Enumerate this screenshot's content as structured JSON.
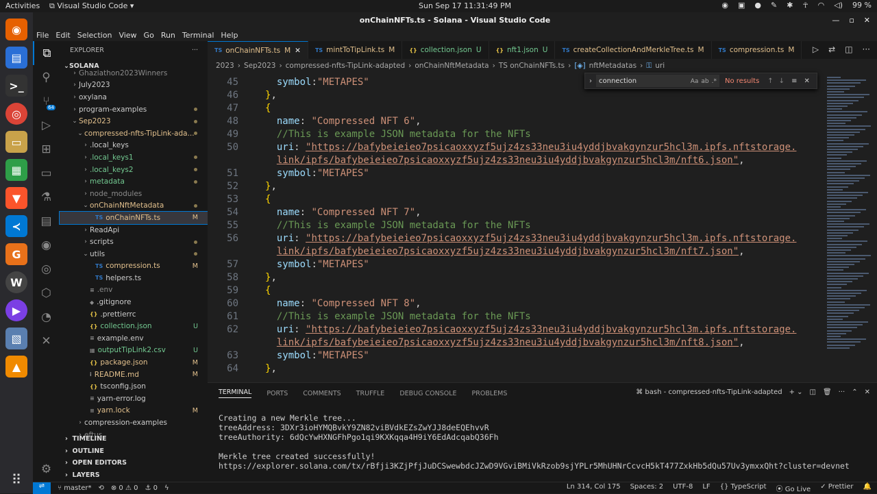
{
  "os": {
    "activities": "Activities",
    "app_name": "Visual Studio Code",
    "clock": "Sun Sep 17  11:31:49 PM",
    "battery": "99 %"
  },
  "window": {
    "title": "onChainNFTs.ts - Solana - Visual Studio Code"
  },
  "menu": [
    "File",
    "Edit",
    "Selection",
    "View",
    "Go",
    "Run",
    "Terminal",
    "Help"
  ],
  "activity": {
    "scm_badge": "64"
  },
  "explorer": {
    "header": "EXPLORER",
    "root": "SOLANA",
    "tree": [
      {
        "label": "Ghaziathon2023Winners",
        "depth": 1,
        "folder": true,
        "open": false,
        "color": "dim"
      },
      {
        "label": "July2023",
        "depth": 1,
        "folder": true,
        "open": false
      },
      {
        "label": "oxylana",
        "depth": 1,
        "folder": true,
        "open": false
      },
      {
        "label": "program-examples",
        "depth": 1,
        "folder": true,
        "open": false,
        "dot": true
      },
      {
        "label": "Sep2023",
        "depth": 1,
        "folder": true,
        "open": true,
        "color": "mod",
        "dot": true
      },
      {
        "label": "compressed-nfts-TipLink-ada...",
        "depth": 2,
        "folder": true,
        "open": true,
        "color": "mod",
        "dot": true
      },
      {
        "label": ".local_keys",
        "depth": 3,
        "folder": true,
        "open": false
      },
      {
        "label": ".local_keys1",
        "depth": 3,
        "folder": true,
        "open": false,
        "color": "untr",
        "dot": true
      },
      {
        "label": ".local_keys2",
        "depth": 3,
        "folder": true,
        "open": false,
        "color": "untr",
        "dot": true
      },
      {
        "label": "metadata",
        "depth": 3,
        "folder": true,
        "open": false,
        "color": "untr",
        "dot": true
      },
      {
        "label": "node_modules",
        "depth": 3,
        "folder": true,
        "open": false,
        "color": "dim"
      },
      {
        "label": "onChainNftMetadata",
        "depth": 3,
        "folder": true,
        "open": true,
        "color": "mod",
        "dot": true
      },
      {
        "label": "onChainNFTs.ts",
        "depth": 4,
        "icon": "TS",
        "status": "M",
        "color": "mod",
        "selected": true
      },
      {
        "label": "ReadApi",
        "depth": 3,
        "folder": true,
        "open": false
      },
      {
        "label": "scripts",
        "depth": 3,
        "folder": true,
        "open": false,
        "dot": true
      },
      {
        "label": "utils",
        "depth": 3,
        "folder": true,
        "open": true,
        "dot": true
      },
      {
        "label": "compression.ts",
        "depth": 4,
        "icon": "TS",
        "status": "M",
        "color": "mod"
      },
      {
        "label": "helpers.ts",
        "depth": 4,
        "icon": "TS"
      },
      {
        "label": ".env",
        "depth": 3,
        "icon": "≡",
        "color": "dim"
      },
      {
        "label": ".gitignore",
        "depth": 3,
        "icon": "◆"
      },
      {
        "label": ".prettierrc",
        "depth": 3,
        "icon": "{}"
      },
      {
        "label": "collection.json",
        "depth": 3,
        "icon": "{}",
        "status": "U",
        "color": "untr"
      },
      {
        "label": "example.env",
        "depth": 3,
        "icon": "≡"
      },
      {
        "label": "outputTipLink2.csv",
        "depth": 3,
        "icon": "▦",
        "status": "U",
        "color": "untr"
      },
      {
        "label": "package.json",
        "depth": 3,
        "icon": "{}",
        "status": "M",
        "color": "mod"
      },
      {
        "label": "README.md",
        "depth": 3,
        "icon": "i",
        "status": "M",
        "color": "mod"
      },
      {
        "label": "tsconfig.json",
        "depth": 3,
        "icon": "{}"
      },
      {
        "label": "yarn-error.log",
        "depth": 3,
        "icon": "≡"
      },
      {
        "label": "yarn.lock",
        "depth": 3,
        "icon": "≡",
        "status": "M",
        "color": "mod"
      },
      {
        "label": "compression-examples",
        "depth": 2,
        "folder": true,
        "open": false
      },
      {
        "label": "eftus",
        "depth": 2,
        "folder": true,
        "open": false,
        "color": "dim"
      }
    ],
    "panels": [
      "TIMELINE",
      "OUTLINE",
      "OPEN EDITORS",
      "LAYERS"
    ]
  },
  "tabs": [
    {
      "label": "onChainNFTs.ts",
      "icon": "TS",
      "mark": "M",
      "active": true
    },
    {
      "label": "mintToTipLink.ts",
      "icon": "TS",
      "mark": "M"
    },
    {
      "label": "collection.json",
      "icon": "{}",
      "mark": "U"
    },
    {
      "label": "nft1.json",
      "icon": "{}",
      "mark": "U"
    },
    {
      "label": "createCollectionAndMerkleTree.ts",
      "icon": "TS",
      "mark": "M"
    },
    {
      "label": "compression.ts",
      "icon": "TS",
      "mark": "M"
    }
  ],
  "breadcrumb": [
    "2023",
    "Sep2023",
    "compressed-nfts-TipLink-adapted",
    "onChainNftMetadata",
    "TS onChainNFTs.ts",
    "nftMetadatas",
    "uri"
  ],
  "find": {
    "value": "connection",
    "result": "No results"
  },
  "code": {
    "url6a": "\"https://bafybeieieo7psicaoxxyzf5ujz4zs33neu3iu4yddjbvakgynzur5hcl3m.ipfs.nftstorage.",
    "url6b": "link/ipfs/bafybeieieo7psicaoxxyzf5ujz4zs33neu3iu4yddjbvakgynzur5hcl3m/nft6.json\"",
    "url7a": "\"https://bafybeieieo7psicaoxxyzf5ujz4zs33neu3iu4yddjbvakgynzur5hcl3m.ipfs.nftstorage.",
    "url7b": "link/ipfs/bafybeieieo7psicaoxxyzf5ujz4zs33neu3iu4yddjbvakgynzur5hcl3m/nft7.json\"",
    "url8a": "\"https://bafybeieieo7psicaoxxyzf5ujz4zs33neu3iu4yddjbvakgynzur5hcl3m.ipfs.nftstorage.",
    "url8b": "link/ipfs/bafybeieieo7psicaoxxyzf5ujz4zs33neu3iu4yddjbvakgynzur5hcl3m/nft8.json\"",
    "name6": "\"Compressed NFT 6\"",
    "name7": "\"Compressed NFT 7\"",
    "name8": "\"Compressed NFT 8\"",
    "comment": "//This is example JSON metadata for the NFTs",
    "symbol": "\"METAPES\""
  },
  "terminal": {
    "tabs": [
      "TERMINAL",
      "PORTS",
      "COMMENTS",
      "TRUFFLE",
      "DEBUG CONSOLE",
      "PROBLEMS"
    ],
    "shell": "bash - compressed-nfts-TipLink-adapted",
    "lines": [
      "Creating a new Merkle tree...",
      "treeAddress: 3DXr3ioHYMQBvkY9ZN82viBVdkEZsZwYJJ8deEQEhvvR",
      "treeAuthority: 6dQcYwHXNGFhPgo1qi9KXKqqa4H9iY6EdAdcqabQ36Fh",
      "",
      "Merkle tree created successfully!",
      "https://explorer.solana.com/tx/rBfji3KZjPfjJuDCSwewbdcJZwD9VGviBMiVkRzob9sjYPLr5MhUHNrCcvcH5kT477ZxkHb5dQu57Uv3ymxxQht?cluster=devnet"
    ]
  },
  "status": {
    "branch": "master*",
    "sync": "⟲",
    "problems": "⊗ 0 ⚠ 0",
    "ports": "⚓ 0",
    "position": "Ln 314, Col 175",
    "spaces": "Spaces: 2",
    "encoding": "UTF-8",
    "eol": "LF",
    "language": "{} TypeScript",
    "golive": "⦿ Go Live",
    "prettier": "✓ Prettier"
  }
}
